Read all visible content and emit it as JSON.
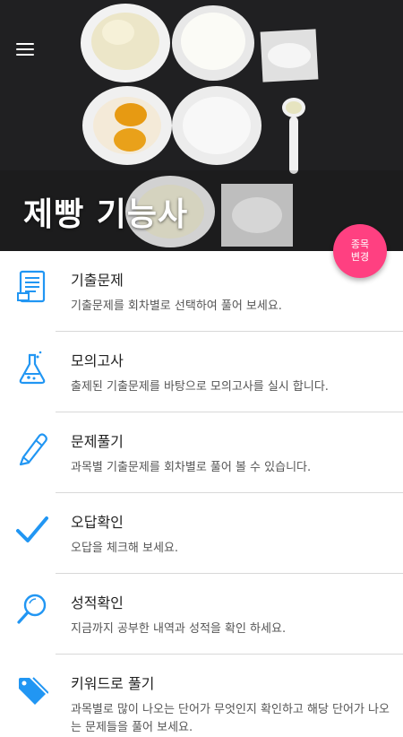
{
  "header": {
    "title": "제빵 기능사",
    "menu_icon": "hamburger-menu-icon"
  },
  "fab": {
    "line1": "종목",
    "line2": "변경",
    "color": "#ff4081"
  },
  "accent_color": "#2196f3",
  "menu": [
    {
      "title": "기출문제",
      "desc": "기출문제를 회차별로 선택하여 풀어 보세요.",
      "icon": "document-list-icon"
    },
    {
      "title": "모의고사",
      "desc": "출제된 기출문제를 바탕으로 모의고사를 실시 합니다.",
      "icon": "flask-icon"
    },
    {
      "title": "문제풀기",
      "desc": "과목별 기출문제를 회차별로 풀어 볼 수 있습니다.",
      "icon": "pencil-icon"
    },
    {
      "title": "오답확인",
      "desc": "오답을 체크해 보세요.",
      "icon": "checkmark-icon"
    },
    {
      "title": "성적확인",
      "desc": "지금까지 공부한 내역과 성적을 확인 하세요.",
      "icon": "magnifier-icon"
    },
    {
      "title": "키워드로 풀기",
      "desc": "과목별로 많이 나오는 단어가 무엇인지 확인하고 해당 단어가 나오는 문제들을 풀어 보세요.",
      "icon": "tag-icon"
    }
  ]
}
